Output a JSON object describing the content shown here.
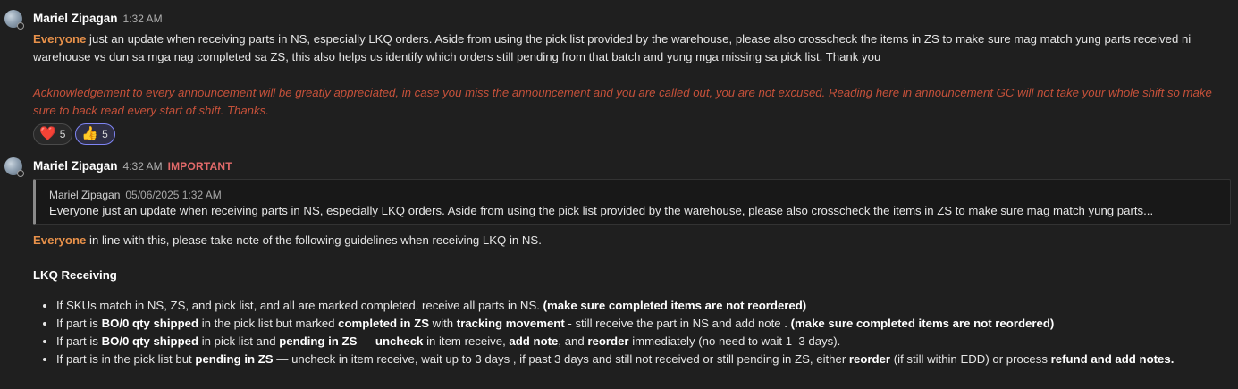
{
  "messages": [
    {
      "author": "Mariel Zipagan",
      "time": "1:32 AM",
      "mention": "Everyone",
      "text": " just an update when receiving parts in NS, especially LKQ orders.  Aside from using the pick list provided by the warehouse, please also crosscheck the items in ZS to make sure mag match yung parts received ni warehouse vs dun sa mga nag completed sa ZS, this also helps us identify which orders still pending from that batch and yung mga missing sa pick list. Thank you",
      "note": "Acknowledgement to every announcement will be greatly appreciated, in case you miss the announcement and you are called out, you are not excused. Reading here in announcement GC will not take your whole shift so make sure to back read every start of shift. Thanks.",
      "reactions": [
        {
          "icon": "heart-icon",
          "glyph": "❤️",
          "count": "5"
        },
        {
          "icon": "thumbs-up-icon",
          "glyph": "👍",
          "count": "5"
        }
      ]
    },
    {
      "author": "Mariel Zipagan",
      "time": "4:32 AM",
      "badge": "IMPORTANT",
      "quote": {
        "author": "Mariel Zipagan",
        "date": "05/06/2025 1:32 AM",
        "text": "Everyone just an update when receiving parts in NS, especially LKQ orders. Aside from using the pick list provided by the warehouse, please also crosscheck the items in ZS to make sure mag match yung parts..."
      },
      "mention": "Everyone",
      "intro": " in line with this,  please take note of the following guidelines when receiving LKQ in NS.",
      "section_title": "LKQ Receiving",
      "guidelines": [
        {
          "t1": "If SKUs match in NS, ZS, and pick list, and all are marked completed, receive all parts in NS. ",
          "b1": "(make sure completed items are not reordered)"
        },
        {
          "t1": "If part is ",
          "b1": "BO/0 qty shipped",
          "t2": " in the pick list but marked ",
          "b2": "completed in ZS",
          "t3": " with ",
          "b3": "tracking movement",
          "t4": " - still receive the part in NS and add note . ",
          "b4": "(make sure completed items are not reordered)"
        },
        {
          "t1": "If part is ",
          "b1": "BO/0 qty shipped",
          "t2": " in pick list and ",
          "b2": "pending in ZS",
          "t3": " — ",
          "b3": "uncheck",
          "t4": " in item receive, ",
          "b4": "add note",
          "t5": ", and ",
          "b5": "reorder",
          "t6": " immediately (no need to wait 1–3 days)."
        },
        {
          "t1": "If part is in the pick list but ",
          "b1": "pending in ZS",
          "t2": " — uncheck in item receive,  wait up to 3 days ,  if past 3 days and still not received or still pending in ZS, either ",
          "b2": "reorder",
          "t3": " (if still within EDD) or process ",
          "b3": "refund and add notes."
        }
      ]
    }
  ],
  "colors": {
    "background": "#1f1f1f",
    "mention": "#e8914a",
    "important": "#e26a6a",
    "note_italic": "#c6513a",
    "reaction_active_border": "#7f85f5"
  }
}
